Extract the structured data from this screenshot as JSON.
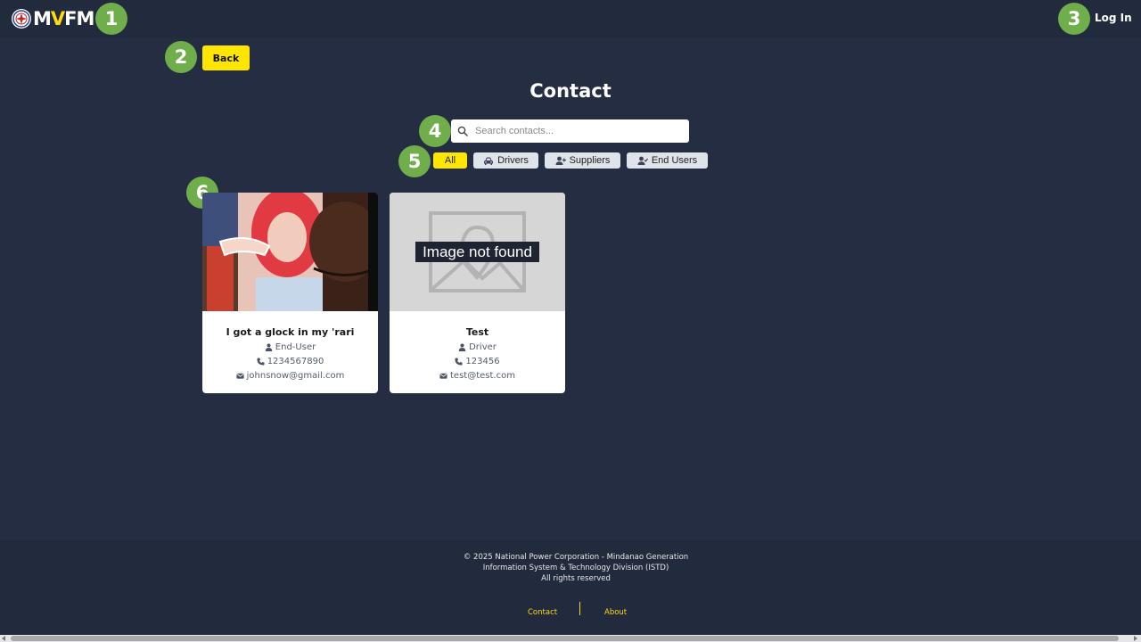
{
  "header": {
    "logo_text_m": "M",
    "logo_text_v": "V",
    "logo_text_fm": "FM",
    "login_label": "Log In"
  },
  "annotations": [
    "1",
    "2",
    "3",
    "4",
    "5",
    "6"
  ],
  "back_label": "Back",
  "page_title": "Contact",
  "search": {
    "placeholder": "Search contacts...",
    "value": ""
  },
  "filters": [
    {
      "label": "All",
      "active": true,
      "icon": ""
    },
    {
      "label": "Drivers",
      "active": false,
      "icon": "car-icon"
    },
    {
      "label": "Suppliers",
      "active": false,
      "icon": "user-plus-icon"
    },
    {
      "label": "End Users",
      "active": false,
      "icon": "user-check-icon"
    }
  ],
  "contacts": [
    {
      "name": "I got a glock in my 'rari",
      "role": "End-User",
      "phone": "1234567890",
      "email": "johnsnow@gmail.com",
      "image": "photo"
    },
    {
      "name": "Test",
      "role": "Driver",
      "phone": "123456",
      "email": "test@test.com",
      "image": "missing",
      "image_fallback_text": "Image not found"
    }
  ],
  "footer": {
    "line1": "© 2025 National Power Corporation - Mindanao Generation",
    "line2": "Information System & Technology Division (ISTD)",
    "line3": "All rights reserved",
    "links": [
      "Contact",
      "About"
    ]
  },
  "colors": {
    "background": "#252d42",
    "header": "#222a3d",
    "accent_yellow": "#ffe600",
    "badge_green": "#6fae4a"
  }
}
